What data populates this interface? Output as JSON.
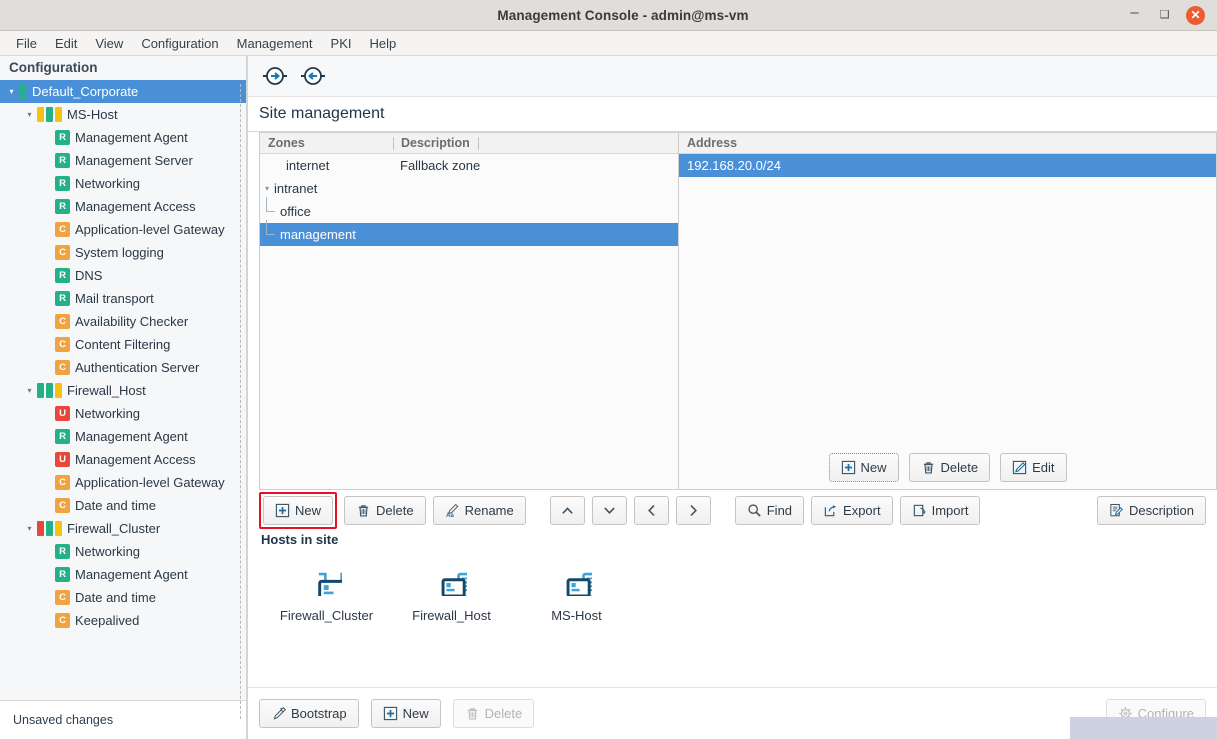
{
  "window": {
    "title": "Management Console - admin@ms-vm",
    "minimize_label": "–",
    "maximize_label": "❑",
    "close_label": "✕"
  },
  "menubar": {
    "items": [
      {
        "label": "File"
      },
      {
        "label": "Edit"
      },
      {
        "label": "View"
      },
      {
        "label": "Configuration"
      },
      {
        "label": "Management"
      },
      {
        "label": "PKI"
      },
      {
        "label": "Help"
      }
    ]
  },
  "sidebar": {
    "header": "Configuration",
    "items": [
      {
        "label": "Default_Corporate",
        "depth": 0,
        "arrow": "▾",
        "kind": "bar",
        "colors": [
          "#23b189"
        ],
        "selected": true
      },
      {
        "label": "MS-Host",
        "depth": 1,
        "arrow": "▾",
        "kind": "bars",
        "colors": [
          "#f5c211",
          "#23b189",
          "#f5c211"
        ]
      },
      {
        "label": "Management Agent",
        "depth": 2,
        "kind": "badge",
        "badge": "R"
      },
      {
        "label": "Management Server",
        "depth": 2,
        "kind": "badge",
        "badge": "R"
      },
      {
        "label": "Networking",
        "depth": 2,
        "kind": "badge",
        "badge": "R"
      },
      {
        "label": "Management Access",
        "depth": 2,
        "kind": "badge",
        "badge": "R"
      },
      {
        "label": "Application-level Gateway",
        "depth": 2,
        "kind": "badge",
        "badge": "C"
      },
      {
        "label": "System logging",
        "depth": 2,
        "kind": "badge",
        "badge": "C"
      },
      {
        "label": "DNS",
        "depth": 2,
        "kind": "badge",
        "badge": "R"
      },
      {
        "label": "Mail transport",
        "depth": 2,
        "kind": "badge",
        "badge": "R"
      },
      {
        "label": "Availability Checker",
        "depth": 2,
        "kind": "badge",
        "badge": "C"
      },
      {
        "label": "Content Filtering",
        "depth": 2,
        "kind": "badge",
        "badge": "C"
      },
      {
        "label": "Authentication Server",
        "depth": 2,
        "kind": "badge",
        "badge": "C"
      },
      {
        "label": "Firewall_Host",
        "depth": 1,
        "arrow": "▾",
        "kind": "bars",
        "colors": [
          "#23b189",
          "#23b189",
          "#f5c211"
        ]
      },
      {
        "label": "Networking",
        "depth": 2,
        "kind": "badge",
        "badge": "U"
      },
      {
        "label": "Management Agent",
        "depth": 2,
        "kind": "badge",
        "badge": "R"
      },
      {
        "label": "Management Access",
        "depth": 2,
        "kind": "badge",
        "badge": "U"
      },
      {
        "label": "Application-level Gateway",
        "depth": 2,
        "kind": "badge",
        "badge": "C"
      },
      {
        "label": "Date and time",
        "depth": 2,
        "kind": "badge",
        "badge": "C"
      },
      {
        "label": "Firewall_Cluster",
        "depth": 1,
        "arrow": "▾",
        "kind": "bars",
        "colors": [
          "#e8483c",
          "#23b189",
          "#f5c211"
        ]
      },
      {
        "label": "Networking",
        "depth": 2,
        "kind": "badge",
        "badge": "R"
      },
      {
        "label": "Management Agent",
        "depth": 2,
        "kind": "badge",
        "badge": "R"
      },
      {
        "label": "Date and time",
        "depth": 2,
        "kind": "badge",
        "badge": "C"
      },
      {
        "label": "Keepalived",
        "depth": 2,
        "kind": "badge",
        "badge": "C"
      }
    ]
  },
  "statusbar": {
    "text": "Unsaved changes"
  },
  "nav_toolbar": {
    "forward_label": "forward-icon",
    "back_label": "back-icon"
  },
  "page": {
    "title": "Site management"
  },
  "zones_panel": {
    "columns": [
      "Zones",
      "Description"
    ],
    "rows": [
      {
        "name": "internet",
        "description": "Fallback zone",
        "depth": 1,
        "arrow": "",
        "selected": false
      },
      {
        "name": "intranet",
        "description": "",
        "depth": 0,
        "arrow": "▾",
        "selected": false
      },
      {
        "name": "office",
        "description": "",
        "depth": 2,
        "arrow": "",
        "selected": false,
        "elbow": true
      },
      {
        "name": "management",
        "description": "",
        "depth": 2,
        "arrow": "",
        "selected": true,
        "elbow": true,
        "last": true
      }
    ]
  },
  "address_panel": {
    "column": "Address",
    "rows": [
      {
        "value": "192.168.20.0/24",
        "selected": true
      }
    ],
    "buttons": [
      {
        "label": "New",
        "icon": "plus-box-icon",
        "focus": true,
        "disabled": false
      },
      {
        "label": "Delete",
        "icon": "trash-icon",
        "focus": false,
        "disabled": false
      },
      {
        "label": "Edit",
        "icon": "pencil-box-icon",
        "focus": false,
        "disabled": false
      }
    ]
  },
  "main_toolbar": {
    "buttons": [
      {
        "label": "New",
        "icon": "plus-box-icon",
        "highlighted": true
      },
      {
        "label": "Delete",
        "icon": "trash-icon"
      },
      {
        "label": "Rename",
        "icon": "rename-icon"
      },
      {
        "label": "",
        "icon": "chevron-up-icon"
      },
      {
        "label": "",
        "icon": "chevron-down-icon"
      },
      {
        "label": "",
        "icon": "chevron-left-icon"
      },
      {
        "label": "",
        "icon": "chevron-right-icon"
      },
      {
        "label": "Find",
        "icon": "search-icon"
      },
      {
        "label": "Export",
        "icon": "export-icon"
      },
      {
        "label": "Import",
        "icon": "import-icon"
      }
    ],
    "description_button": {
      "label": "Description",
      "icon": "description-icon"
    }
  },
  "hosts_section": {
    "label": "Hosts in site",
    "hosts": [
      {
        "name": "Firewall_Cluster",
        "icon": "cluster-host-icon"
      },
      {
        "name": "Firewall_Host",
        "icon": "server-host-icon"
      },
      {
        "name": "MS-Host",
        "icon": "server-host-icon"
      }
    ]
  },
  "bottom_bar": {
    "buttons": [
      {
        "label": "Bootstrap",
        "icon": "wand-icon",
        "disabled": false
      },
      {
        "label": "New",
        "icon": "plus-box-icon",
        "disabled": false
      },
      {
        "label": "Delete",
        "icon": "trash-icon",
        "disabled": true
      }
    ],
    "configure_button": {
      "label": "Configure",
      "icon": "gear-icon",
      "disabled": true
    }
  },
  "colors": {
    "selection": "#4a90d9",
    "highlight": "#e81123",
    "badge_r": "#23b189",
    "badge_c": "#f0a341",
    "badge_u": "#e8483c",
    "icon_blue": "#1a6ea8"
  }
}
